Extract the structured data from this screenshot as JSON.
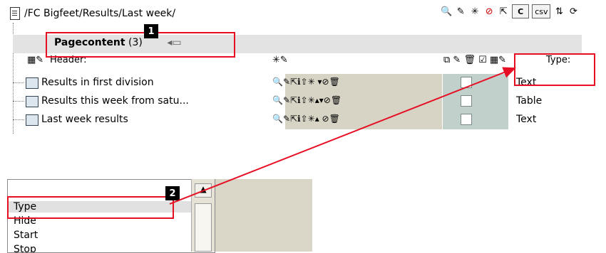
{
  "breadcrumb": {
    "path": "/FC Bigfeet/Results/Last week/"
  },
  "toolbar": {
    "icons": [
      "search-icon",
      "edit-icon",
      "new-record-icon",
      "delete-toggle-icon",
      "export-icon",
      "clipboard-icon",
      "csv-button",
      "sort-icon",
      "refresh-icon"
    ],
    "c_label": "C",
    "csv_label": "csv"
  },
  "section": {
    "title": "Pagecontent",
    "count": "(3)"
  },
  "columns": {
    "header": "Header:",
    "type": "Type:"
  },
  "rows": [
    {
      "title": "Results in first division",
      "type": "Text"
    },
    {
      "title": "Results this week from satu...",
      "type": "Table"
    },
    {
      "title": "Last week results",
      "type": "Text"
    }
  ],
  "dropdown": {
    "options": [
      "Type",
      "Hide",
      "Start",
      "Stop"
    ]
  },
  "annotations": {
    "badge1": "1",
    "badge2": "2"
  },
  "colors": {
    "callout": "#e60f23",
    "band": "#e3e3e3",
    "olive": "#d7d4c6",
    "checkbox_cell": "#c2d0cc"
  }
}
